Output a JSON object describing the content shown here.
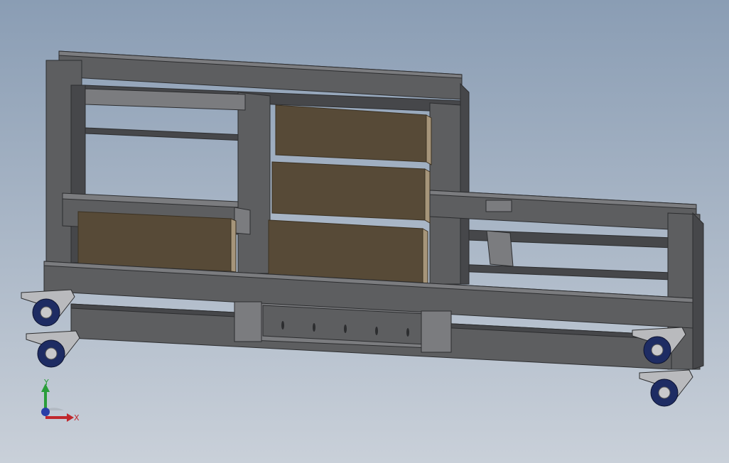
{
  "viewport": {
    "background_top": "#8a9db4",
    "background_bottom": "#c9d0d9"
  },
  "colors": {
    "frame_fill": "#5d5e60",
    "frame_dark": "#46474a",
    "frame_light": "#7b7c7f",
    "frame_edge": "#2c2d2f",
    "box_fill": "#574a37",
    "box_edge": "#3b3122",
    "box_side": "#a6957a",
    "wheel_tread": "#1e2c63",
    "wheel_hub": "#c9c9cb",
    "bracket": "#b9babd"
  },
  "triad": {
    "x_label": "X",
    "y_label": "Y",
    "x_color": "#c0282d",
    "y_color": "#2a9d3a",
    "z_color": "#2a3fa8"
  },
  "icons": {
    "triad": "coordinate-triad-icon",
    "caster": "caster-wheel-icon"
  }
}
